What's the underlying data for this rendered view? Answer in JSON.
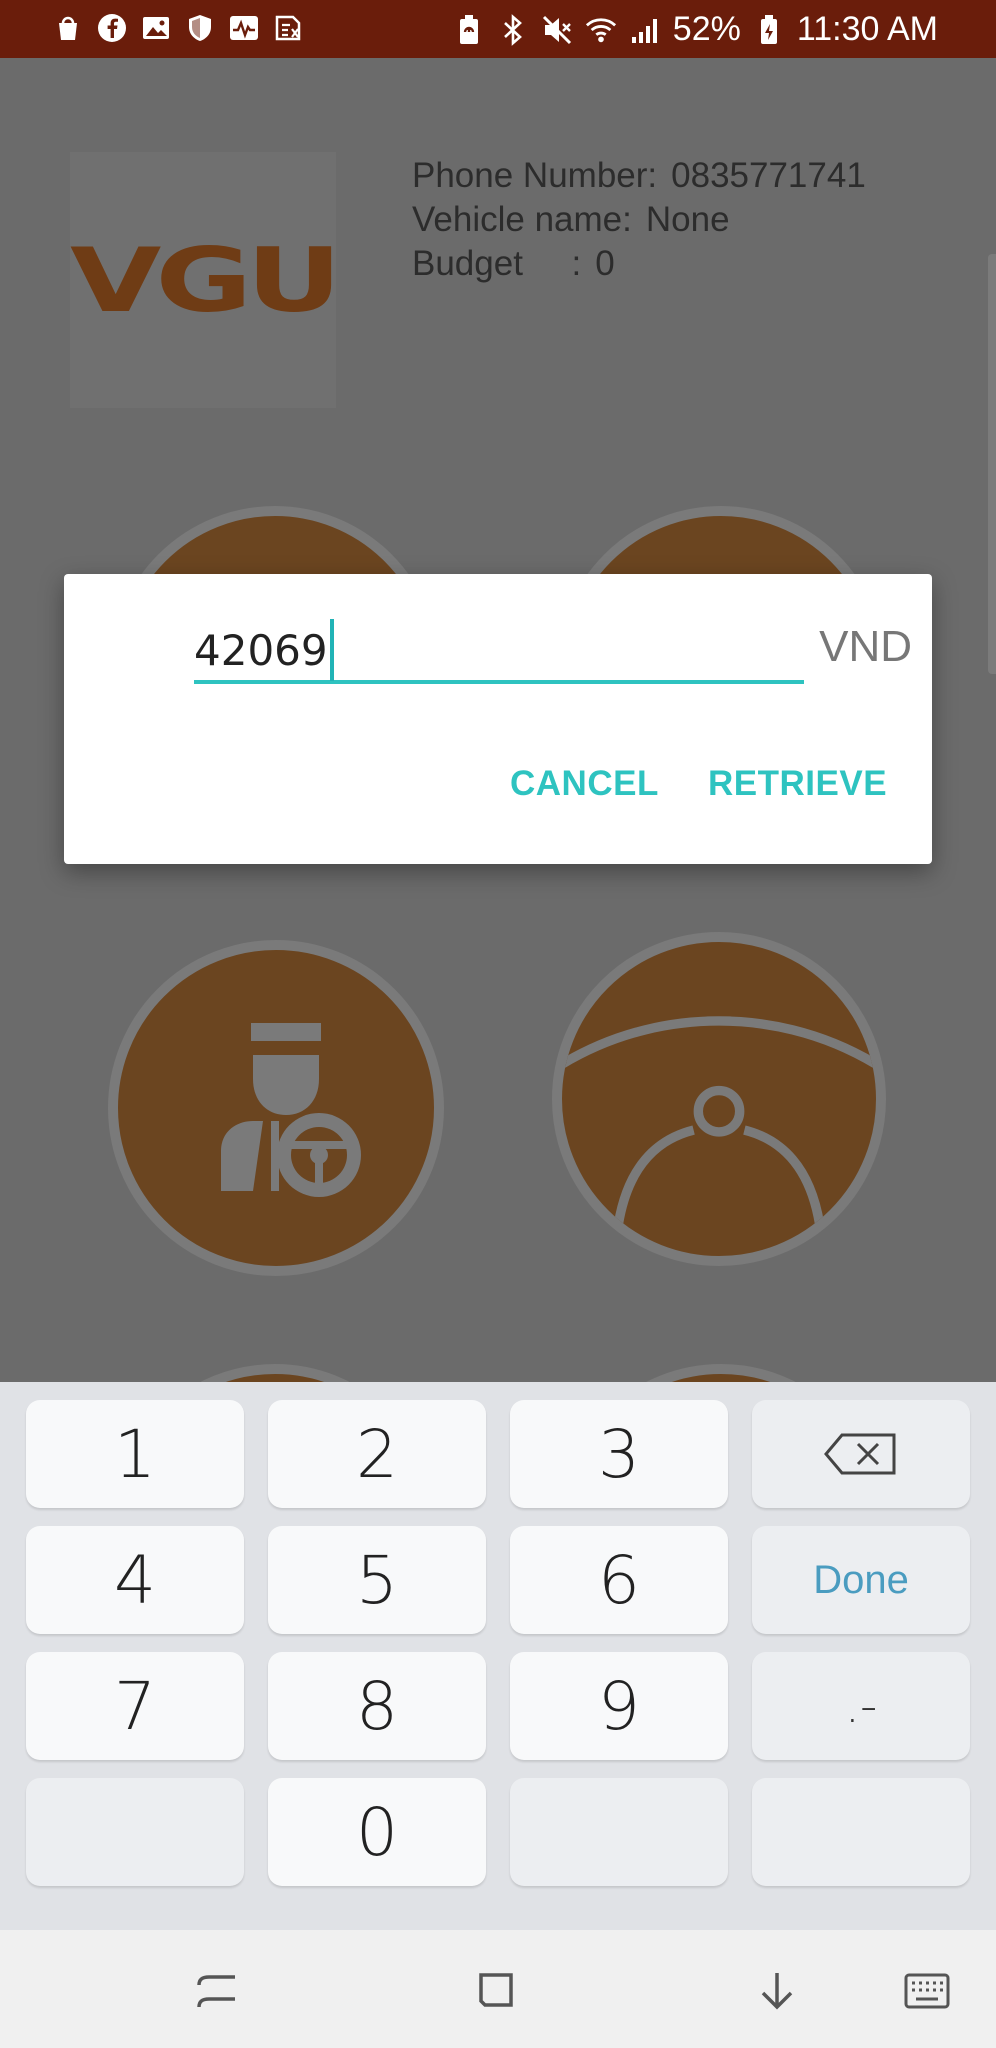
{
  "status_bar": {
    "battery_percent": "52%",
    "time": "11:30 AM",
    "left_icons": [
      "shopping-bag-icon",
      "facebook-icon",
      "gallery-icon",
      "shield-icon",
      "activity-icon",
      "sim-icon"
    ],
    "right_icons": [
      "battery-saver-icon",
      "bluetooth-icon",
      "mute-icon",
      "wifi-icon",
      "signal-icon",
      "battery-icon"
    ]
  },
  "profile": {
    "logo_text": "VGU",
    "phone_label": "Phone Number:",
    "phone_value": "0835771741",
    "vehicle_label": "Vehicle name:",
    "vehicle_value": "None",
    "budget_label": "Budget     :",
    "budget_value": "0"
  },
  "dialog": {
    "amount_value": "42069",
    "unit": "VND",
    "cancel_label": "CANCEL",
    "retrieve_label": "RETRIEVE"
  },
  "keypad": {
    "keys": [
      "1",
      "2",
      "3",
      "4",
      "5",
      "6",
      "7",
      "8",
      "9",
      "0"
    ],
    "done_label": "Done",
    "symbol_label": ".-"
  },
  "colors": {
    "status_bar": "#6a1d0b",
    "accent": "#2ec3c0",
    "brand": "#6f3c15",
    "done": "#4a9cc0"
  }
}
